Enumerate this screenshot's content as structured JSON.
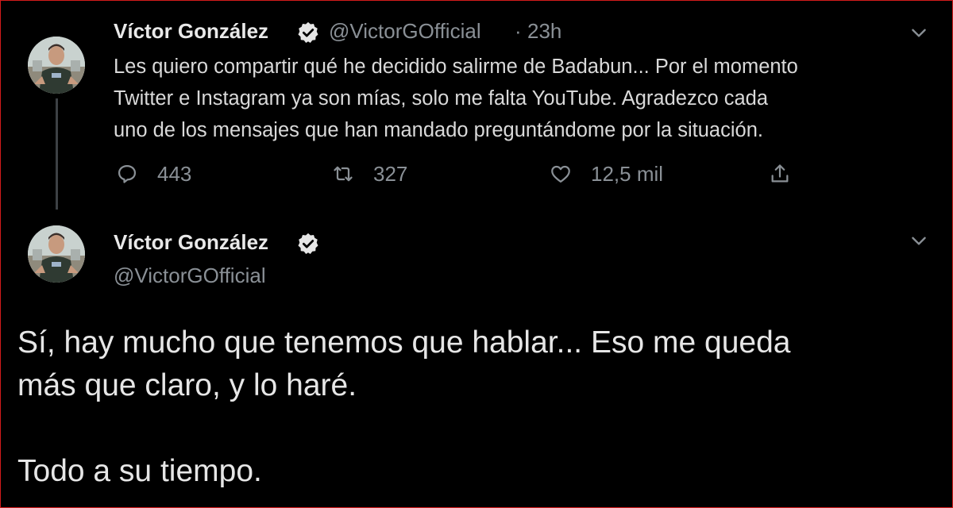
{
  "tweet1": {
    "display_name": "Víctor González",
    "handle": "@VictorGOfficial",
    "separator": "·",
    "time": "23h",
    "text_lines": [
      "Les quiero compartir qué he decidido salirme de Badabun... Por el momento",
      "Twitter e Instagram  ya son mías, solo me falta YouTube. Agradezco cada",
      "uno de los mensajes que han mandado preguntándome por la situación."
    ],
    "replies": "443",
    "retweets": "327",
    "likes": "12,5 mil",
    "icons": {
      "reply": "reply-icon",
      "retweet": "retweet-icon",
      "like": "heart-icon",
      "share": "share-icon",
      "more": "chevron-down-icon",
      "verified": "verified-badge-icon"
    }
  },
  "tweet2": {
    "display_name": "Víctor González",
    "handle": "@VictorGOfficial",
    "text_lines": [
      "Sí, hay mucho que tenemos que hablar... Eso me queda",
      "más que claro, y lo haré.",
      "",
      "Todo a su tiempo."
    ]
  },
  "colors": {
    "background": "#000000",
    "primary_text": "#d9d9d9",
    "secondary_text": "#8a9096",
    "thread_line": "#3d4145",
    "frame_border": "#d21b1b"
  }
}
